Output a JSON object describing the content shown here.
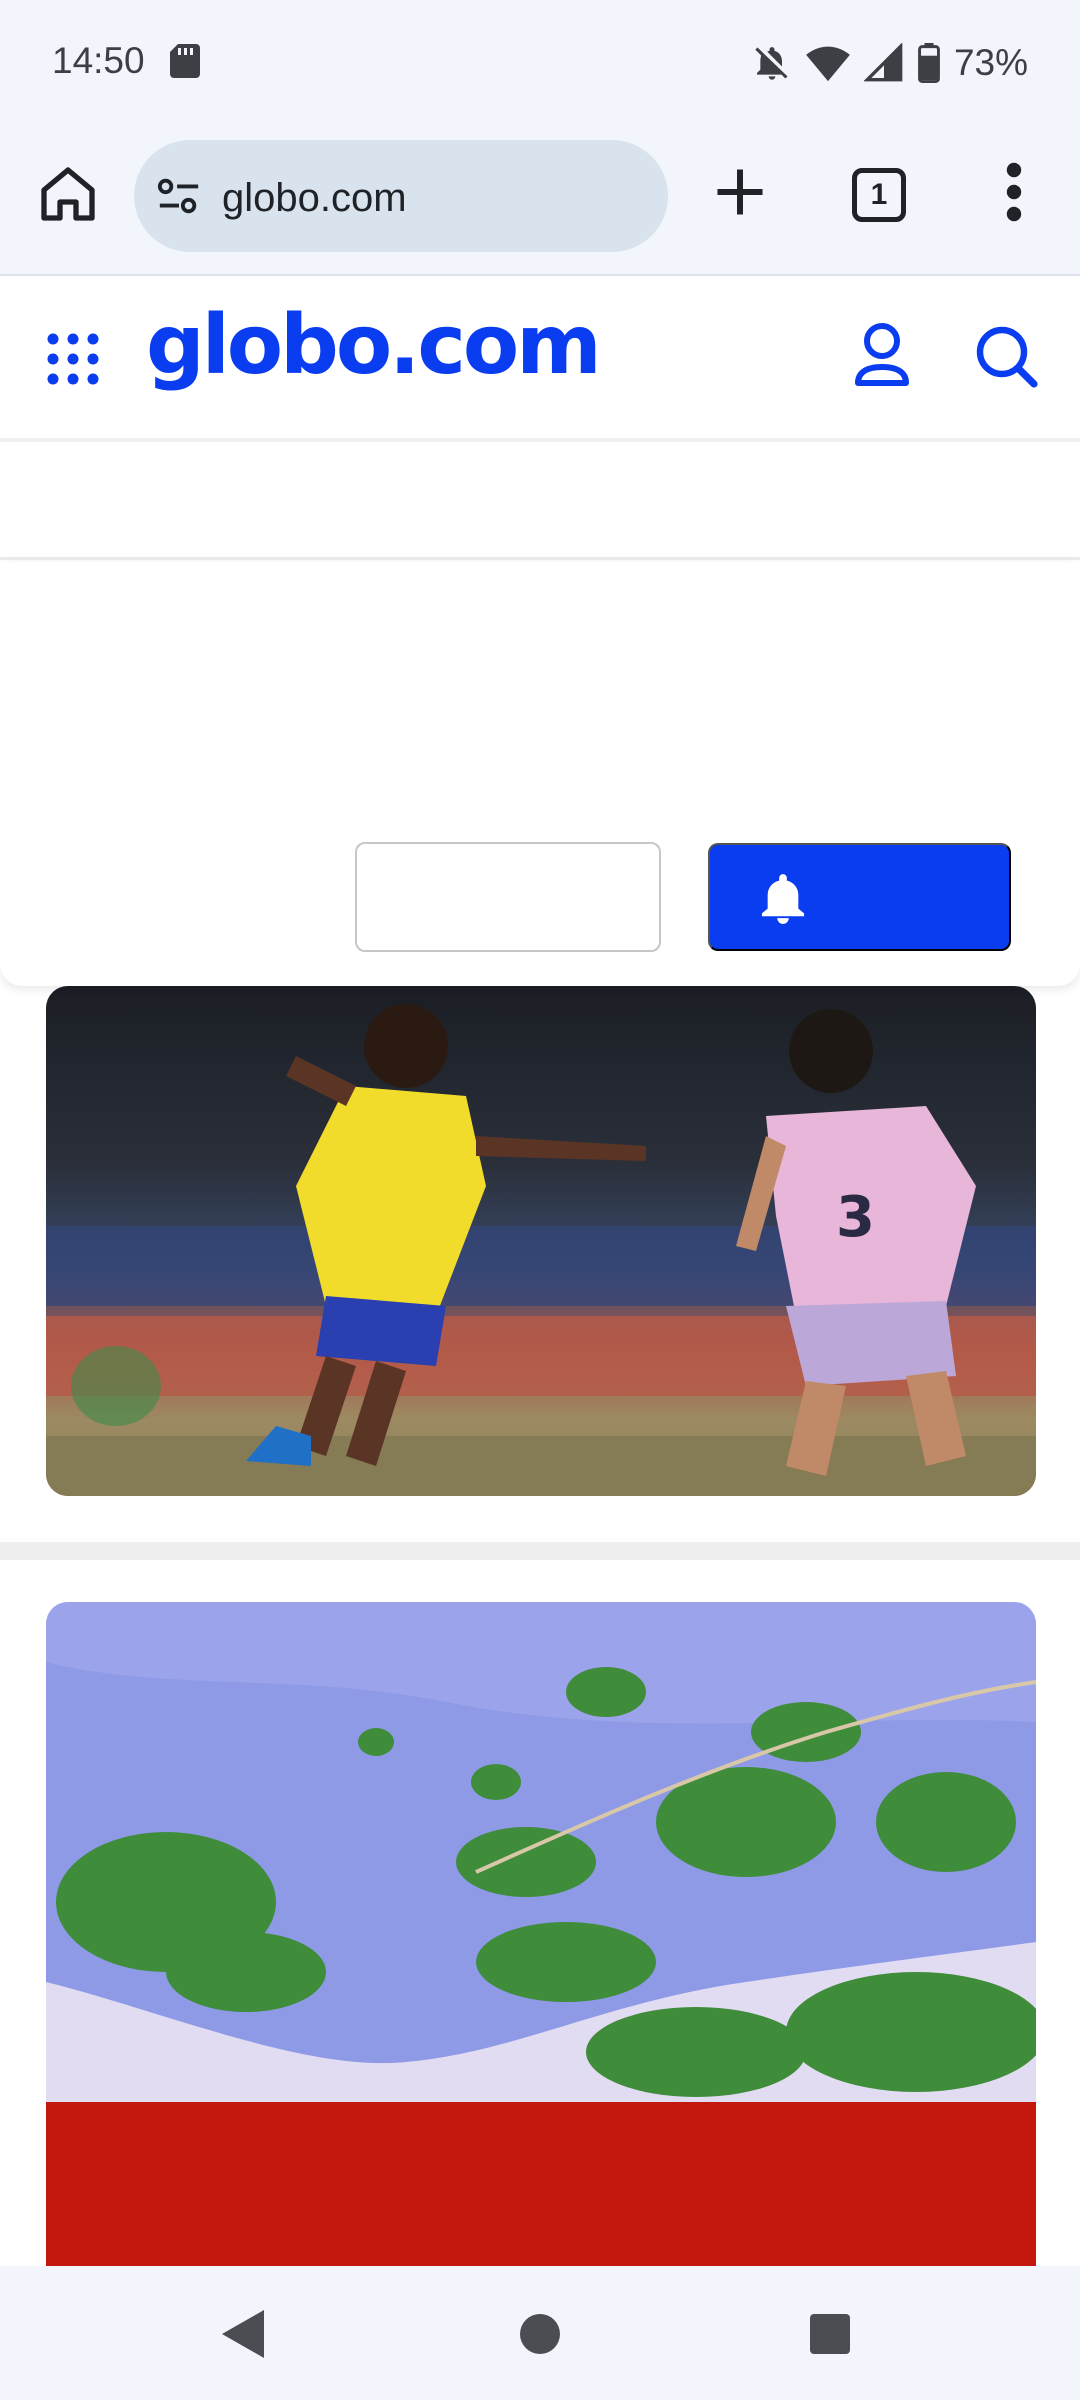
{
  "status_bar": {
    "time": "14:50",
    "battery": "73%",
    "icons": [
      "sd-card-icon",
      "notifications-off-icon",
      "wifi-icon",
      "cell-signal-icon",
      "battery-icon"
    ]
  },
  "browser": {
    "url": "globo.com",
    "tab_count": "1",
    "icons": [
      "home-icon",
      "site-settings-icon",
      "new-tab-icon",
      "tab-switcher-icon",
      "more-menu-icon"
    ]
  },
  "site": {
    "logo": "globo.com",
    "brand_color": "#0a3cf0",
    "icons": [
      "apps-grid-icon",
      "user-icon",
      "search-icon"
    ]
  },
  "notification_prompt": {
    "decline_label": "",
    "accept_label": "",
    "accept_icon": "bell-icon"
  },
  "feed": {
    "images": [
      {
        "name": "football-match-image"
      },
      {
        "name": "flood-aerial-image"
      }
    ],
    "banner_color": "#c4180e"
  },
  "nav_bar": {
    "icons": [
      "back-icon",
      "home-circle-icon",
      "recents-icon"
    ]
  }
}
